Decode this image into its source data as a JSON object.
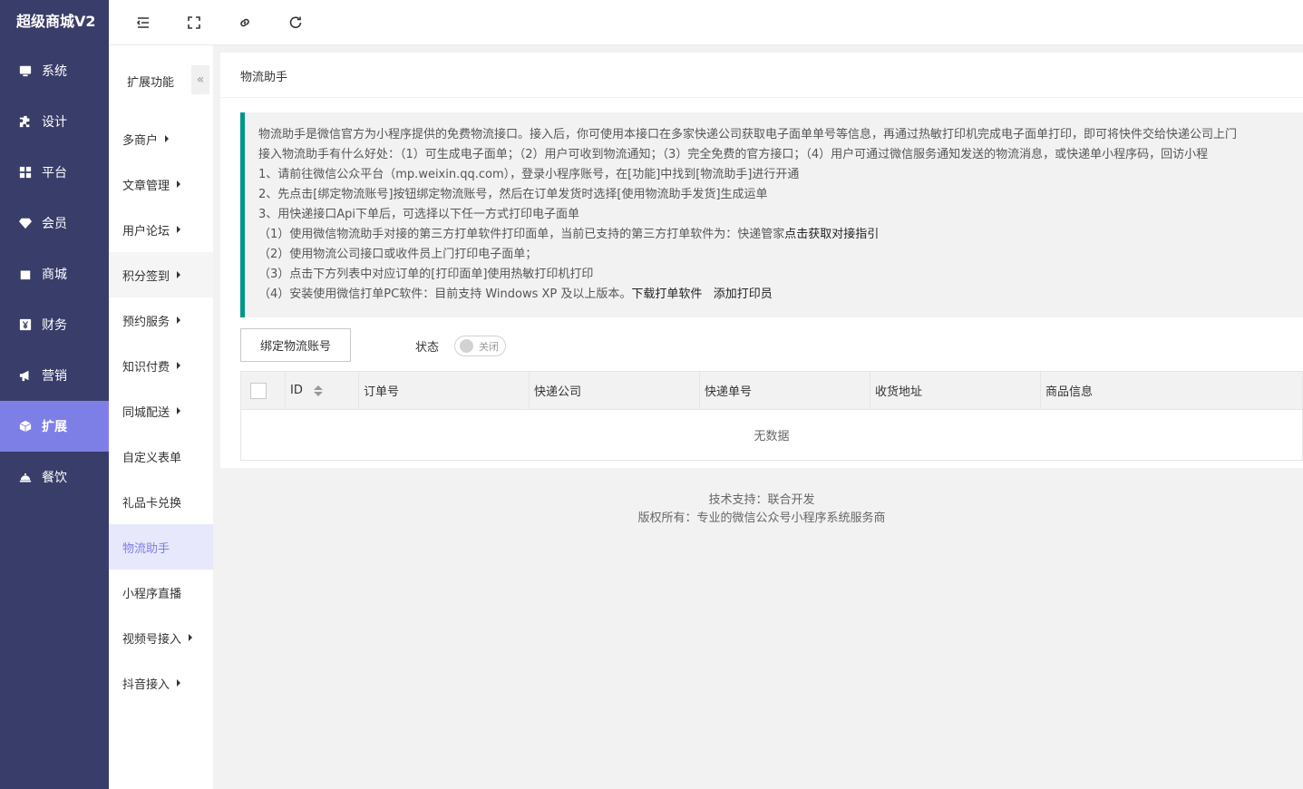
{
  "app": {
    "logo": "超级商城V2"
  },
  "sidebar": {
    "items": [
      {
        "label": "系统",
        "icon": "monitor-icon"
      },
      {
        "label": "设计",
        "icon": "puzzle-icon"
      },
      {
        "label": "平台",
        "icon": "grid-icon"
      },
      {
        "label": "会员",
        "icon": "diamond-icon"
      },
      {
        "label": "商城",
        "icon": "shopping-bag-icon"
      },
      {
        "label": "财务",
        "icon": "yen-icon"
      },
      {
        "label": "营销",
        "icon": "megaphone-icon"
      },
      {
        "label": "扩展",
        "icon": "cube-icon",
        "active": true
      },
      {
        "label": "餐饮",
        "icon": "cloche-icon"
      }
    ]
  },
  "topbar": {
    "icons": [
      "menu-fold-icon",
      "fullscreen-icon",
      "link-icon",
      "refresh-icon"
    ]
  },
  "submenu": {
    "title": "扩展功能",
    "collapse": "«",
    "items": [
      {
        "label": "多商户",
        "caret": true
      },
      {
        "label": "文章管理",
        "caret": true
      },
      {
        "label": "用户论坛",
        "caret": true
      },
      {
        "label": "积分签到",
        "caret": true,
        "hover": true
      },
      {
        "label": "预约服务",
        "caret": true
      },
      {
        "label": "知识付费",
        "caret": true
      },
      {
        "label": "同城配送",
        "caret": true
      },
      {
        "label": "自定义表单",
        "caret": false
      },
      {
        "label": "礼品卡兑换",
        "caret": false
      },
      {
        "label": "物流助手",
        "caret": false,
        "active": true
      },
      {
        "label": "小程序直播",
        "caret": false
      },
      {
        "label": "视频号接入",
        "caret": true
      },
      {
        "label": "抖音接入",
        "caret": true
      }
    ]
  },
  "main": {
    "title": "物流助手",
    "notice": {
      "lines": [
        "物流助手是微信官方为小程序提供的免费物流接口。接入后，你可使用本接口在多家快递公司获取电子面单单号等信息，再通过热敏打印机完成电子面单打印，即可将快件交给快递公司上门",
        "接入物流助手有什么好处：（1）可生成电子面单；（2）用户可收到物流通知；（3）完全免费的官方接口；（4）用户可通过微信服务通知发送的物流消息，或快递单小程序码，回访小程",
        "1、请前往微信公众平台（mp.weixin.qq.com），登录小程序账号，在[功能]中找到[物流助手]进行开通",
        "2、先点击[绑定物流账号]按钮绑定物流账号，然后在订单发货时选择[使用物流助手发货]生成运单",
        "3、用快递接口Api下单后，可选择以下任一方式打印电子面单"
      ],
      "line6_prefix": "（1）使用微信物流助手对接的第三方打单软件打印面单，当前已支持的第三方打单软件为：快递管家",
      "line6_link": "点击获取对接指引",
      "line7": "（2）使用物流公司接口或收件员上门打印电子面单；",
      "line8": "（3）点击下方列表中对应订单的[打印面单]使用热敏打印机打印",
      "line9_prefix": "（4）安装使用微信打单PC软件：目前支持 Windows XP 及以上版本。",
      "line9_link1": "下载打单软件",
      "line9_link2": "添加打印员"
    },
    "bind_button": "绑定物流账号",
    "status_label": "状态",
    "switch_text": "关闭",
    "table": {
      "columns": [
        "ID",
        "订单号",
        "快递公司",
        "快递单号",
        "收货地址",
        "商品信息"
      ],
      "empty": "无数据"
    }
  },
  "footer": {
    "line1": "技术支持：联合开发",
    "line2": "版权所有：专业的微信公众号小程序系统服务商"
  },
  "colors": {
    "sidebar_bg": "#393d69",
    "accent": "#7d7fe6",
    "notice_border": "#009688"
  }
}
